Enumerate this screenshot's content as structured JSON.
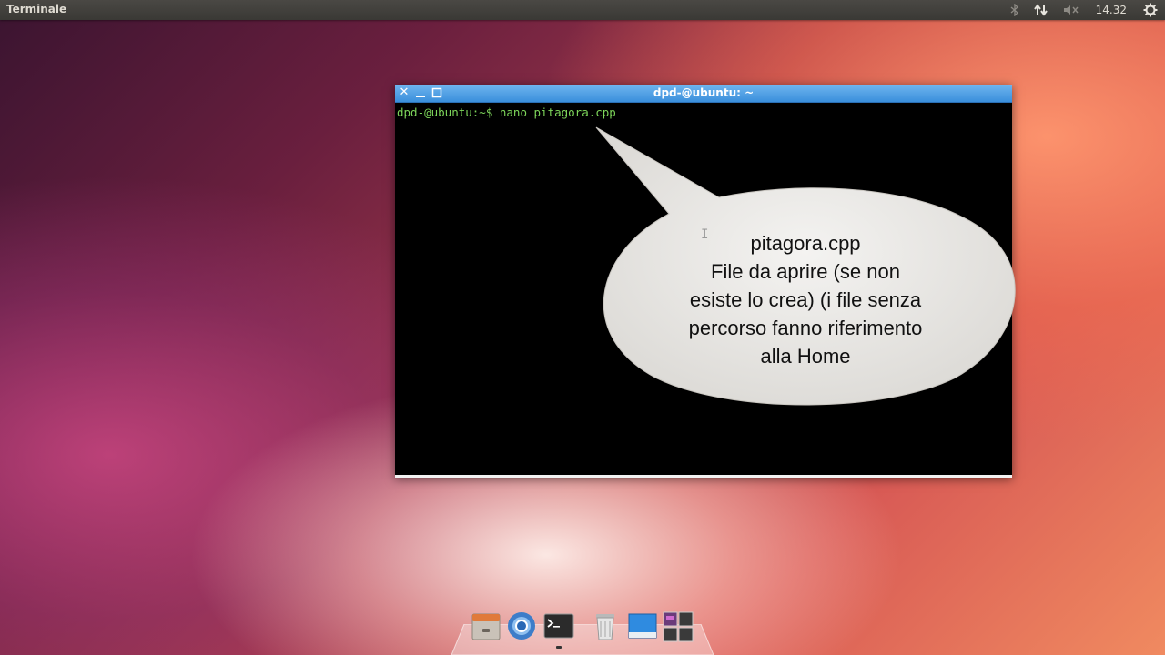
{
  "panel": {
    "app_title": "Terminale",
    "clock": "14.32",
    "icons": [
      "bluetooth-icon",
      "network-icon",
      "volume-muted-icon",
      "power-gear-icon"
    ]
  },
  "terminal": {
    "title": "dpd-@ubuntu: ~",
    "command_line": "dpd-@ubuntu:~$ nano pitagora.cpp",
    "text_color": "#7dd65a",
    "titlebar_color": "#3a8fdc"
  },
  "callout": {
    "lines": [
      "pitagora.cpp",
      "File da aprire (se non",
      "esiste lo crea) (i file senza",
      "percorso fanno riferimento",
      "alla Home"
    ]
  },
  "dock": {
    "items": [
      "file-manager-icon",
      "chromium-browser-icon",
      "terminal-icon",
      "trash-icon",
      "desktop-icon",
      "workspace-switcher-icon"
    ]
  }
}
